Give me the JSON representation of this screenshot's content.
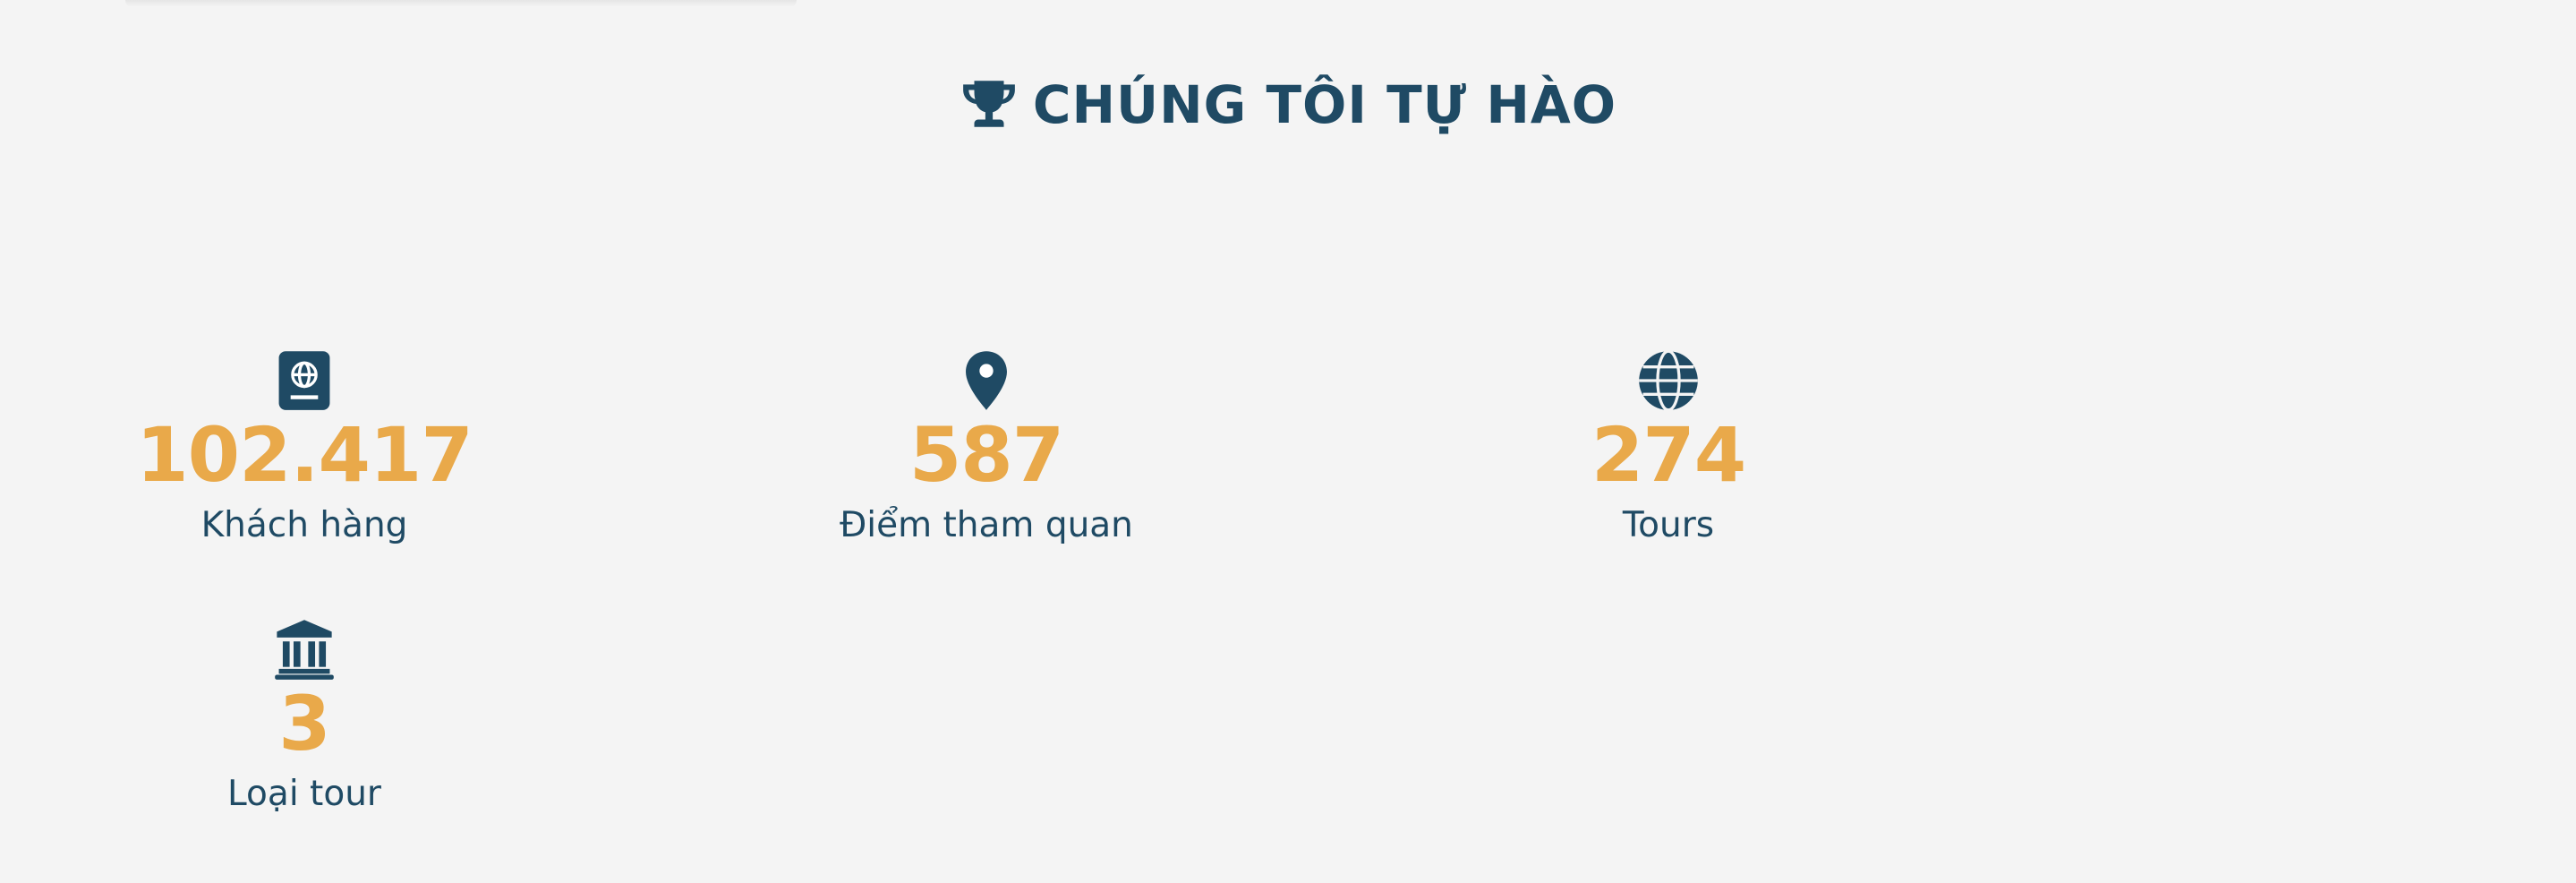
{
  "section": {
    "title": "CHÚNG TÔI TỰ HÀO",
    "title_icon": "trophy-icon"
  },
  "stats": [
    {
      "icon": "passport-icon",
      "value": "102.417",
      "label": "Khách hàng"
    },
    {
      "icon": "map-marker-icon",
      "value": "587",
      "label": "Điểm tham quan"
    },
    {
      "icon": "globe-icon",
      "value": "274",
      "label": "Tours"
    },
    {
      "icon": "landmark-icon",
      "value": "3",
      "label": "Loại tour"
    }
  ],
  "colors": {
    "background": "#f4f4f4",
    "primary": "#1f4a64",
    "accent": "#e9a94a"
  }
}
